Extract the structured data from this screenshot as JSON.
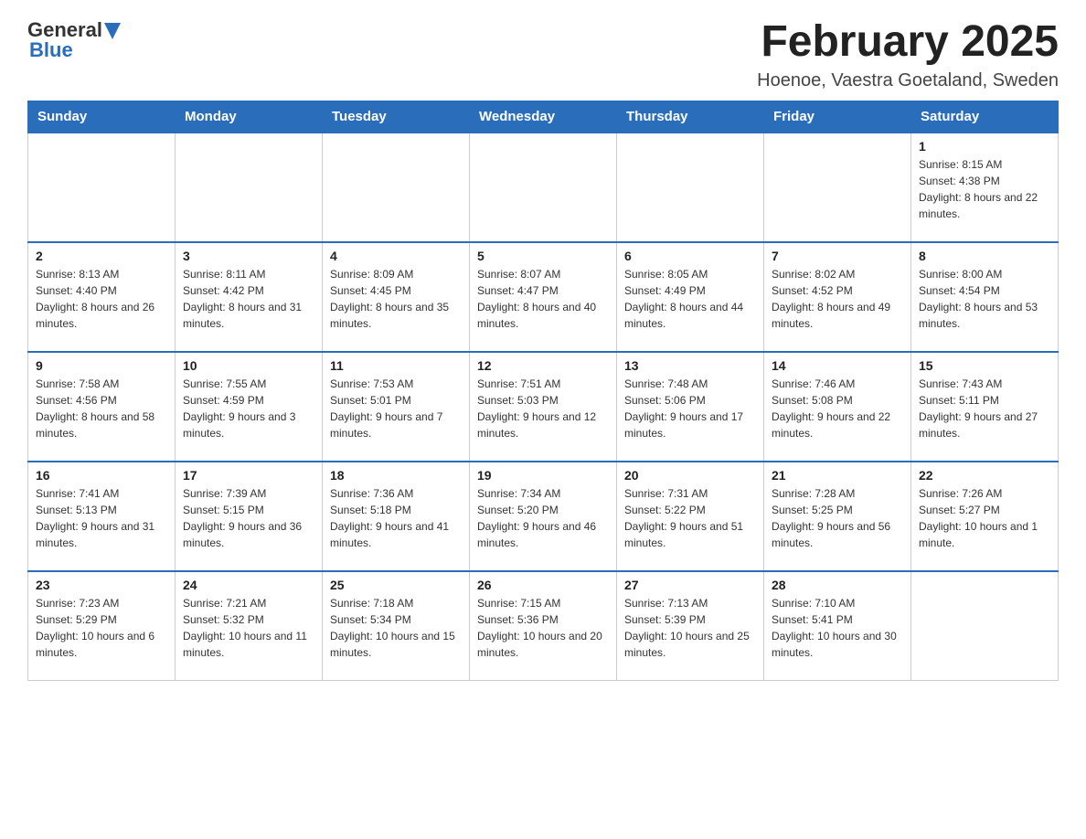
{
  "header": {
    "logo_general": "General",
    "logo_blue": "Blue",
    "month_year": "February 2025",
    "location": "Hoenoe, Vaestra Goetaland, Sweden"
  },
  "weekdays": [
    "Sunday",
    "Monday",
    "Tuesday",
    "Wednesday",
    "Thursday",
    "Friday",
    "Saturday"
  ],
  "weeks": [
    [
      {
        "day": "",
        "info": ""
      },
      {
        "day": "",
        "info": ""
      },
      {
        "day": "",
        "info": ""
      },
      {
        "day": "",
        "info": ""
      },
      {
        "day": "",
        "info": ""
      },
      {
        "day": "",
        "info": ""
      },
      {
        "day": "1",
        "info": "Sunrise: 8:15 AM\nSunset: 4:38 PM\nDaylight: 8 hours and 22 minutes."
      }
    ],
    [
      {
        "day": "2",
        "info": "Sunrise: 8:13 AM\nSunset: 4:40 PM\nDaylight: 8 hours and 26 minutes."
      },
      {
        "day": "3",
        "info": "Sunrise: 8:11 AM\nSunset: 4:42 PM\nDaylight: 8 hours and 31 minutes."
      },
      {
        "day": "4",
        "info": "Sunrise: 8:09 AM\nSunset: 4:45 PM\nDaylight: 8 hours and 35 minutes."
      },
      {
        "day": "5",
        "info": "Sunrise: 8:07 AM\nSunset: 4:47 PM\nDaylight: 8 hours and 40 minutes."
      },
      {
        "day": "6",
        "info": "Sunrise: 8:05 AM\nSunset: 4:49 PM\nDaylight: 8 hours and 44 minutes."
      },
      {
        "day": "7",
        "info": "Sunrise: 8:02 AM\nSunset: 4:52 PM\nDaylight: 8 hours and 49 minutes."
      },
      {
        "day": "8",
        "info": "Sunrise: 8:00 AM\nSunset: 4:54 PM\nDaylight: 8 hours and 53 minutes."
      }
    ],
    [
      {
        "day": "9",
        "info": "Sunrise: 7:58 AM\nSunset: 4:56 PM\nDaylight: 8 hours and 58 minutes."
      },
      {
        "day": "10",
        "info": "Sunrise: 7:55 AM\nSunset: 4:59 PM\nDaylight: 9 hours and 3 minutes."
      },
      {
        "day": "11",
        "info": "Sunrise: 7:53 AM\nSunset: 5:01 PM\nDaylight: 9 hours and 7 minutes."
      },
      {
        "day": "12",
        "info": "Sunrise: 7:51 AM\nSunset: 5:03 PM\nDaylight: 9 hours and 12 minutes."
      },
      {
        "day": "13",
        "info": "Sunrise: 7:48 AM\nSunset: 5:06 PM\nDaylight: 9 hours and 17 minutes."
      },
      {
        "day": "14",
        "info": "Sunrise: 7:46 AM\nSunset: 5:08 PM\nDaylight: 9 hours and 22 minutes."
      },
      {
        "day": "15",
        "info": "Sunrise: 7:43 AM\nSunset: 5:11 PM\nDaylight: 9 hours and 27 minutes."
      }
    ],
    [
      {
        "day": "16",
        "info": "Sunrise: 7:41 AM\nSunset: 5:13 PM\nDaylight: 9 hours and 31 minutes."
      },
      {
        "day": "17",
        "info": "Sunrise: 7:39 AM\nSunset: 5:15 PM\nDaylight: 9 hours and 36 minutes."
      },
      {
        "day": "18",
        "info": "Sunrise: 7:36 AM\nSunset: 5:18 PM\nDaylight: 9 hours and 41 minutes."
      },
      {
        "day": "19",
        "info": "Sunrise: 7:34 AM\nSunset: 5:20 PM\nDaylight: 9 hours and 46 minutes."
      },
      {
        "day": "20",
        "info": "Sunrise: 7:31 AM\nSunset: 5:22 PM\nDaylight: 9 hours and 51 minutes."
      },
      {
        "day": "21",
        "info": "Sunrise: 7:28 AM\nSunset: 5:25 PM\nDaylight: 9 hours and 56 minutes."
      },
      {
        "day": "22",
        "info": "Sunrise: 7:26 AM\nSunset: 5:27 PM\nDaylight: 10 hours and 1 minute."
      }
    ],
    [
      {
        "day": "23",
        "info": "Sunrise: 7:23 AM\nSunset: 5:29 PM\nDaylight: 10 hours and 6 minutes."
      },
      {
        "day": "24",
        "info": "Sunrise: 7:21 AM\nSunset: 5:32 PM\nDaylight: 10 hours and 11 minutes."
      },
      {
        "day": "25",
        "info": "Sunrise: 7:18 AM\nSunset: 5:34 PM\nDaylight: 10 hours and 15 minutes."
      },
      {
        "day": "26",
        "info": "Sunrise: 7:15 AM\nSunset: 5:36 PM\nDaylight: 10 hours and 20 minutes."
      },
      {
        "day": "27",
        "info": "Sunrise: 7:13 AM\nSunset: 5:39 PM\nDaylight: 10 hours and 25 minutes."
      },
      {
        "day": "28",
        "info": "Sunrise: 7:10 AM\nSunset: 5:41 PM\nDaylight: 10 hours and 30 minutes."
      },
      {
        "day": "",
        "info": ""
      }
    ]
  ]
}
